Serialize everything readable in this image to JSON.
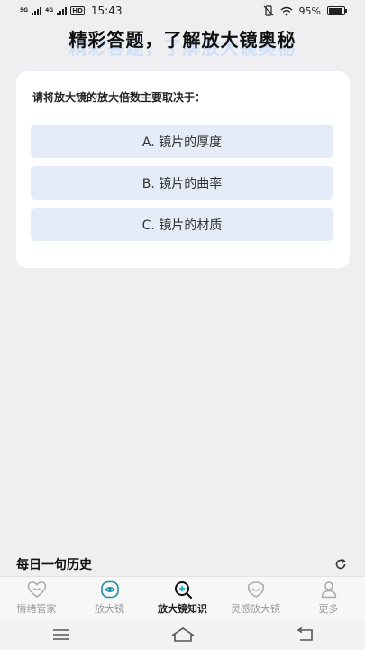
{
  "status": {
    "network_small": "5G",
    "network_small2": "4G",
    "hd": "HD",
    "time": "15:43",
    "battery": "95%",
    "battery_level": 0.95
  },
  "page": {
    "title": "精彩答题，了解放大镜奥秘"
  },
  "quiz": {
    "question": "请将放大镜的放大倍数主要取决于：",
    "options": [
      {
        "label": "A. 镜片的厚度"
      },
      {
        "label": "B. 镜片的曲率"
      },
      {
        "label": "C. 镜片的材质"
      }
    ]
  },
  "history": {
    "title": "每日一句历史"
  },
  "tabs": [
    {
      "label": "情绪管家",
      "icon": "heart-icon"
    },
    {
      "label": "放大镜",
      "icon": "eye-icon"
    },
    {
      "label": "放大镜知识",
      "icon": "magnifier-icon",
      "active": true
    },
    {
      "label": "灵感放大镜",
      "icon": "smile-icon"
    },
    {
      "label": "更多",
      "icon": "person-icon"
    }
  ],
  "colors": {
    "accent": "#1e8ca6",
    "option_bg": "#e4ecf8",
    "title_shadow": "#cfe0f7"
  }
}
